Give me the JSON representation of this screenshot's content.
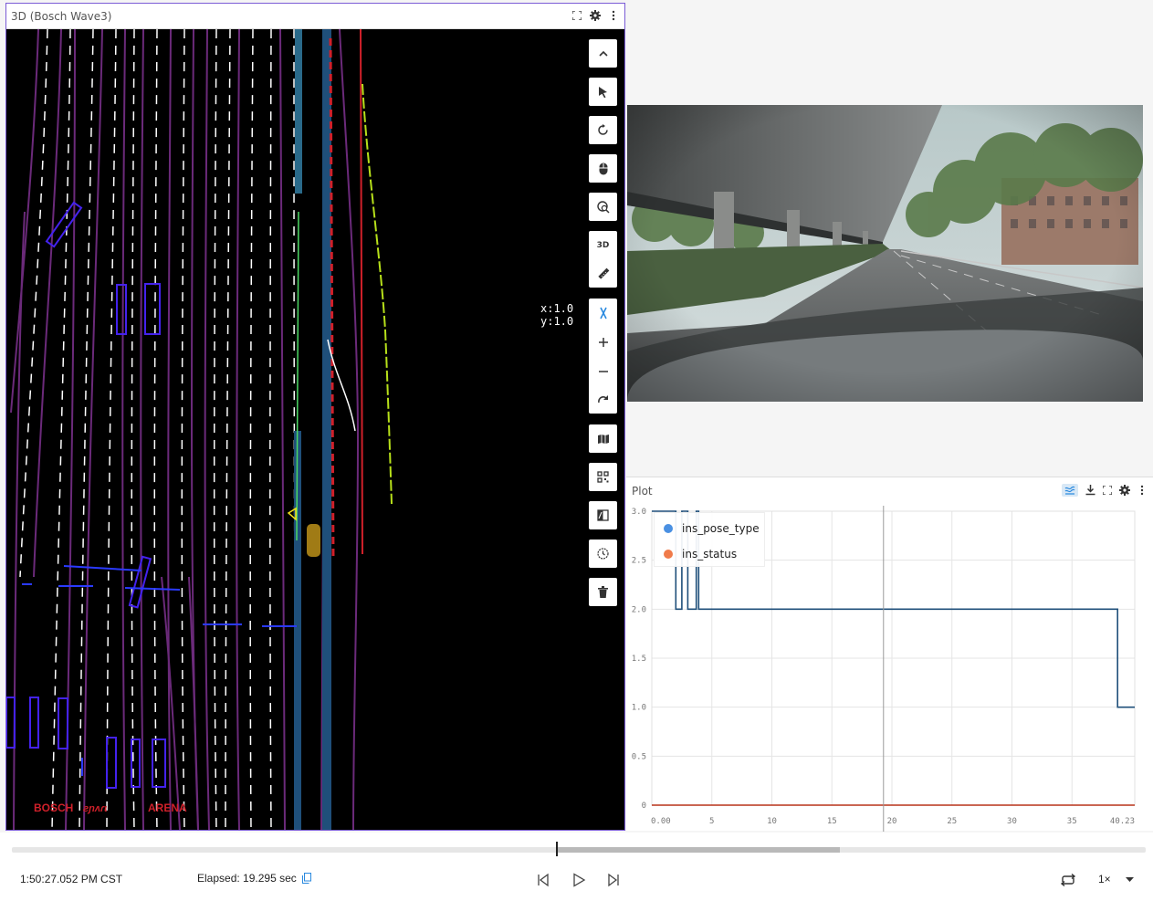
{
  "panel3d": {
    "title": "3D (Bosch Wave3)",
    "coords": "x:1.0\ny:1.0",
    "logo_text": [
      "BOSCH",
      "ARENA"
    ],
    "toolbar": {
      "collapse_icon": "chevron-up-icon",
      "mode_3d": "3D"
    }
  },
  "plot": {
    "title": "Plot",
    "legend": [
      {
        "name": "ins_pose_type",
        "color": "#4a90e2"
      },
      {
        "name": "ins_status",
        "color": "#f07b4a"
      }
    ]
  },
  "chart_data": {
    "type": "line",
    "xlabel": "",
    "ylabel": "",
    "xlim": [
      0,
      40.23
    ],
    "ylim": [
      0,
      3.0
    ],
    "x_ticks": [
      "0.00",
      "5",
      "10",
      "15",
      "20",
      "25",
      "30",
      "35",
      "40.23"
    ],
    "y_ticks": [
      "0",
      "0.5",
      "1.0",
      "1.5",
      "2.0",
      "2.5",
      "3.0"
    ],
    "cursor_x": 19.3,
    "series": [
      {
        "name": "ins_pose_type",
        "color": "#4a90e2",
        "step": true,
        "points": [
          [
            0,
            3
          ],
          [
            2,
            3
          ],
          [
            2,
            2
          ],
          [
            2.5,
            2
          ],
          [
            2.5,
            3
          ],
          [
            3,
            3
          ],
          [
            3,
            2
          ],
          [
            3.7,
            2
          ],
          [
            3.7,
            3
          ],
          [
            3.9,
            3
          ],
          [
            3.9,
            2
          ],
          [
            38.8,
            2
          ],
          [
            38.8,
            1
          ],
          [
            40.23,
            1
          ]
        ]
      },
      {
        "name": "ins_status",
        "color": "#c0392b",
        "step": true,
        "points": [
          [
            0,
            0
          ],
          [
            40.23,
            0
          ]
        ]
      }
    ]
  },
  "playback": {
    "time": "1:50:27.052 PM CST",
    "elapsed": "Elapsed: 19.295 sec",
    "speed": "1×",
    "progress": 0.48,
    "buffered_end": 0.73
  }
}
